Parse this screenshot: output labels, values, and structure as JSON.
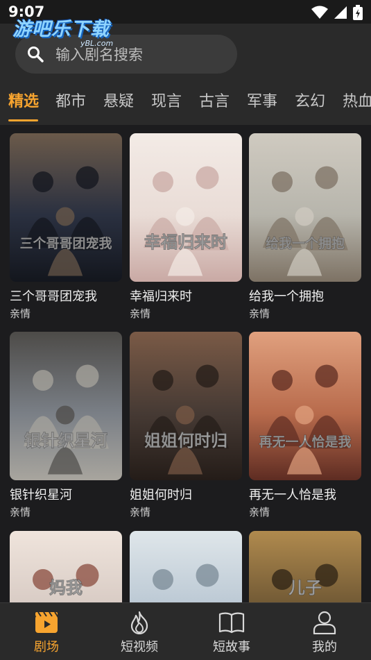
{
  "status": {
    "time": "9:07"
  },
  "logo": {
    "main": "游吧乐下载",
    "sub": "yBL.com"
  },
  "search": {
    "placeholder": "输入剧名搜索"
  },
  "tabs": [
    "精选",
    "都市",
    "悬疑",
    "现言",
    "古言",
    "军事",
    "玄幻",
    "热血"
  ],
  "active_tab": "精选",
  "dramas": [
    {
      "title": "三个哥哥团宠我",
      "genre": "亲情",
      "poster_text": "三个哥哥团宠我",
      "colors": [
        "#2a3040",
        "#13161d",
        "#6b5a4a"
      ]
    },
    {
      "title": "幸福归来时",
      "genre": "亲情",
      "poster_text": "幸福归来时",
      "colors": [
        "#e9dcd6",
        "#c9a9a4",
        "#f3ebe6"
      ]
    },
    {
      "title": "给我一个拥抱",
      "genre": "亲情",
      "poster_text": "给我一个拥抱",
      "colors": [
        "#b7b5ac",
        "#7d7264",
        "#cfcac0"
      ]
    },
    {
      "title": "银针织星河",
      "genre": "亲情",
      "poster_text": "银针织星河",
      "colors": [
        "#7a7f86",
        "#a8a59e",
        "#4d4b48"
      ]
    },
    {
      "title": "姐姐何时归",
      "genre": "亲情",
      "poster_text": "姐姐何时归",
      "colors": [
        "#463a34",
        "#241c18",
        "#7a5a46"
      ]
    },
    {
      "title": "再无一人恰是我",
      "genre": "亲情",
      "poster_text": "再无一人恰是我",
      "colors": [
        "#b86b4c",
        "#5e2c22",
        "#e0a07e"
      ]
    },
    {
      "title": "",
      "genre": "",
      "poster_text": "妈我",
      "colors": [
        "#d6c9c2",
        "#8a4b3d",
        "#efe4dc"
      ]
    },
    {
      "title": "",
      "genre": "",
      "poster_text": "",
      "colors": [
        "#b8c6d2",
        "#7a8a96",
        "#dfe6ea"
      ]
    },
    {
      "title": "",
      "genre": "",
      "poster_text": "儿子",
      "colors": [
        "#6a5432",
        "#2c2214",
        "#b08a4e"
      ]
    }
  ],
  "nav": [
    {
      "label": "剧场",
      "icon": "theater-icon",
      "active": true
    },
    {
      "label": "短视频",
      "icon": "flame-icon",
      "active": false
    },
    {
      "label": "短故事",
      "icon": "book-icon",
      "active": false
    },
    {
      "label": "我的",
      "icon": "user-icon",
      "active": false
    }
  ],
  "accent": "#f7a42f"
}
